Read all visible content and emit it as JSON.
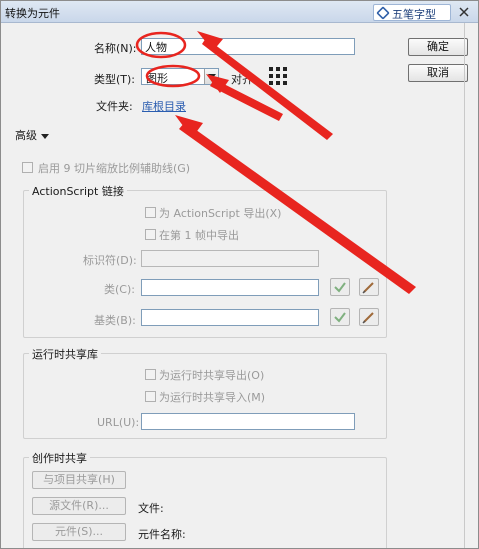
{
  "window": {
    "title": "转换为元件"
  },
  "watermark": {
    "text": "五笔字型"
  },
  "form": {
    "name_label": "名称(N):",
    "name_value": "人物",
    "type_label": "类型(T):",
    "type_value": "图形",
    "align_label": "对齐:",
    "folder_label": "文件夹:",
    "folder_link": "库根目录"
  },
  "buttons": {
    "ok": "确定",
    "cancel": "取消"
  },
  "advanced": {
    "toggle_label": "高级",
    "nine_slice": "启用 9 切片缩放比例辅助线(G)"
  },
  "actionscript": {
    "title": "ActionScript 链接",
    "export_as": "为 ActionScript 导出(X)",
    "export_frame1": "在第 1 帧中导出",
    "identifier_label": "标识符(D):",
    "class_label": "类(C):",
    "base_label": "基类(B):"
  },
  "runtime": {
    "title": "运行时共享库",
    "export_runtime": "为运行时共享导出(O)",
    "import_runtime": "为运行时共享导入(M)",
    "url_label": "URL(U):"
  },
  "authortime": {
    "title": "创作时共享",
    "share_project": "与项目共享(H)",
    "source_file": "源文件(R)...",
    "file_label": "文件:",
    "symbol_button": "元件(S)...",
    "symbol_name_label": "元件名称:"
  },
  "colors": {
    "annotation": "#e8251f",
    "link": "#2a5db0"
  }
}
